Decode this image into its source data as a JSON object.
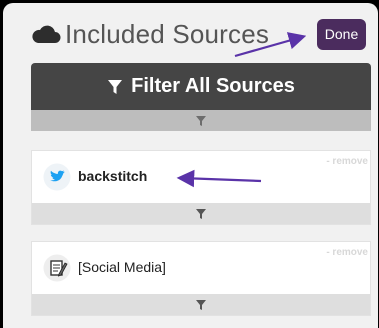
{
  "header": {
    "title": "Included Sources",
    "done_label": "Done"
  },
  "filter_all": {
    "label": "Filter All Sources"
  },
  "sources": [
    {
      "label": "backstitch",
      "icon": "twitter-bird-icon",
      "remove_label": "- remove"
    },
    {
      "label": "[Social Media]",
      "icon": "notepad-pencil-icon",
      "remove_label": "- remove"
    }
  ],
  "colors": {
    "done_button": "#4b2c5e",
    "filter_bar": "#454545",
    "annotation_arrow": "#5a33a8",
    "twitter_blue": "#1da1f2"
  }
}
